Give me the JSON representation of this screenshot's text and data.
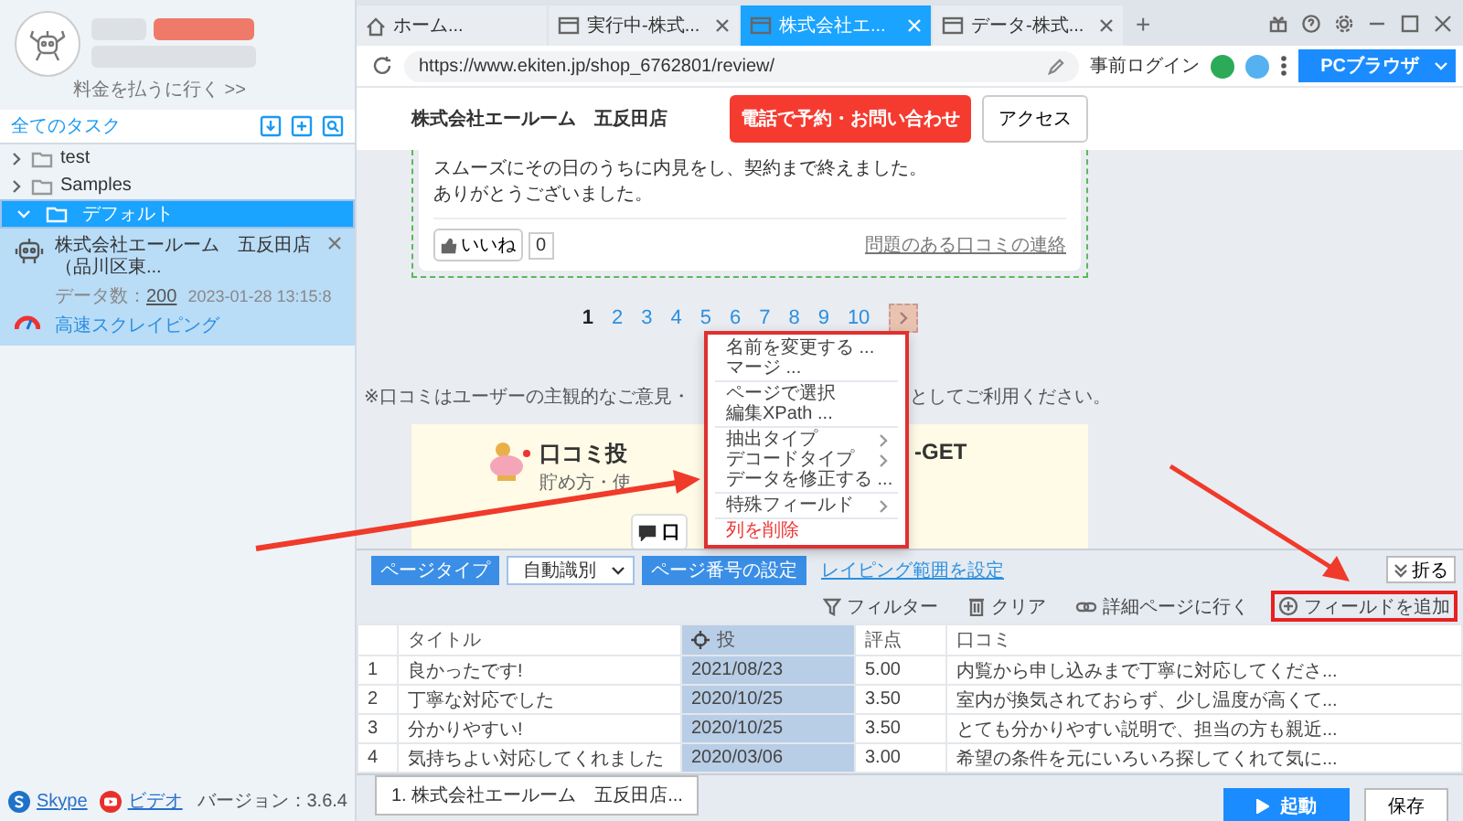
{
  "sidebar": {
    "account_link": "料金を払うに行く >>",
    "section_title": "全てのタスク",
    "tree": [
      {
        "label": "test",
        "expanded": false,
        "selected": false
      },
      {
        "label": "Samples",
        "expanded": false,
        "selected": false
      },
      {
        "label": "デフォルト",
        "expanded": true,
        "selected": true,
        "tasks": [
          {
            "title": "株式会社エールーム　五反田店（品川区東...",
            "count_label": "データ数：",
            "count": "200",
            "time": "2023-01-28 13:15:8",
            "mode": "高速スクレイピング"
          }
        ]
      }
    ],
    "links": [
      {
        "kind": "skype",
        "label": "Skype"
      },
      {
        "kind": "video",
        "label": "ビデオ"
      }
    ],
    "version": "バージョン：3.6.4"
  },
  "browser": {
    "tabs": [
      {
        "kind": "home",
        "label": "ホーム...",
        "selected": false
      },
      {
        "kind": "page",
        "label": "実行中-株式...",
        "selected": false
      },
      {
        "kind": "page",
        "label": "株式会社エ...",
        "selected": true
      },
      {
        "kind": "page",
        "label": "データ-株式...",
        "selected": false
      }
    ],
    "new_tab": "+",
    "url": "https://www.ekiten.jp/shop_6762801/review/",
    "prelogin": "事前ログイン",
    "mode_button": "PCブラウザ"
  },
  "page": {
    "shop_name": "株式会社エールーム　五反田店",
    "call_button": "電話で予約・お問い合わせ",
    "access_button": "アクセス",
    "review_lines": [
      "スムーズにその日のうちに内見をし、契約まで終えました。",
      "ありがとうございました。"
    ],
    "like_button": "いいね",
    "like_count": "0",
    "report_link": "問題のある口コミの連絡",
    "pages": [
      {
        "label": "1",
        "selected": true
      },
      {
        "label": "2",
        "selected": false
      },
      {
        "label": "3",
        "selected": false
      },
      {
        "label": "4",
        "selected": false
      },
      {
        "label": "5",
        "selected": false
      },
      {
        "label": "6",
        "selected": false
      },
      {
        "label": "7",
        "selected": false
      },
      {
        "label": "8",
        "selected": false
      },
      {
        "label": "9",
        "selected": false
      },
      {
        "label": "10",
        "selected": false
      }
    ],
    "notice_parts": [
      "※口コミはユーザーの主観的なご意見・",
      "としてご利用ください。"
    ],
    "banner_title_parts": [
      "口コミ投",
      "-GET"
    ],
    "banner_sub": "貯め方・使",
    "banner_button": "口"
  },
  "context_menu": [
    {
      "kind": "item",
      "label": "名前を変更する ..."
    },
    {
      "kind": "item",
      "label": "マージ ..."
    },
    {
      "kind": "separator"
    },
    {
      "kind": "item",
      "label": "ページで選択"
    },
    {
      "kind": "item",
      "label": "編集XPath ..."
    },
    {
      "kind": "separator"
    },
    {
      "kind": "submenu",
      "label": "抽出タイプ"
    },
    {
      "kind": "submenu",
      "label": "デコードタイプ"
    },
    {
      "kind": "item",
      "label": "データを修正する ..."
    },
    {
      "kind": "separator"
    },
    {
      "kind": "submenu",
      "label": "特殊フィールド"
    },
    {
      "kind": "separator"
    },
    {
      "kind": "danger",
      "label": "列を削除"
    }
  ],
  "panel": {
    "collapse_button": "折る",
    "page_type_button": "ページタイプ",
    "page_type_value": "自動識別",
    "page_number_button": "ページ番号の設定",
    "range_link": "レイピング範囲を設定",
    "actions": [
      {
        "kind": "filter",
        "label": "フィルター",
        "highlighted": false
      },
      {
        "kind": "clear",
        "label": "クリア",
        "highlighted": false
      },
      {
        "kind": "detail",
        "label": "詳細ページに行く",
        "highlighted": false
      },
      {
        "kind": "add",
        "label": "フィールドを追加",
        "highlighted": true
      }
    ],
    "table": {
      "columns": [
        {
          "label": "タイトル",
          "selected": false
        },
        {
          "label": "投",
          "selected": true
        },
        {
          "label": "評点",
          "selected": false
        },
        {
          "label": "口コミ",
          "selected": false
        }
      ],
      "rows": [
        {
          "index": "1",
          "cells": [
            "良かったです!",
            "2021/08/23",
            "5.00",
            "内覧から申し込みまで丁寧に対応してくださ..."
          ]
        },
        {
          "index": "2",
          "cells": [
            "丁寧な対応でした",
            "2020/10/25",
            "3.50",
            "室内が換気されておらず、少し温度が高くて..."
          ]
        },
        {
          "index": "3",
          "cells": [
            "分かりやすい!",
            "2020/10/25",
            "3.50",
            "とても分かりやすい説明で、担当の方も親近..."
          ]
        },
        {
          "index": "4",
          "cells": [
            "気持ちよい対応してくれました",
            "2020/03/06",
            "3.00",
            "希望の条件を元にいろいろ探してくれて気に..."
          ]
        }
      ]
    }
  },
  "footer": {
    "task_tab": "1. 株式会社エールーム　五反田店...",
    "run_button": "起動",
    "save_button": "保存"
  }
}
